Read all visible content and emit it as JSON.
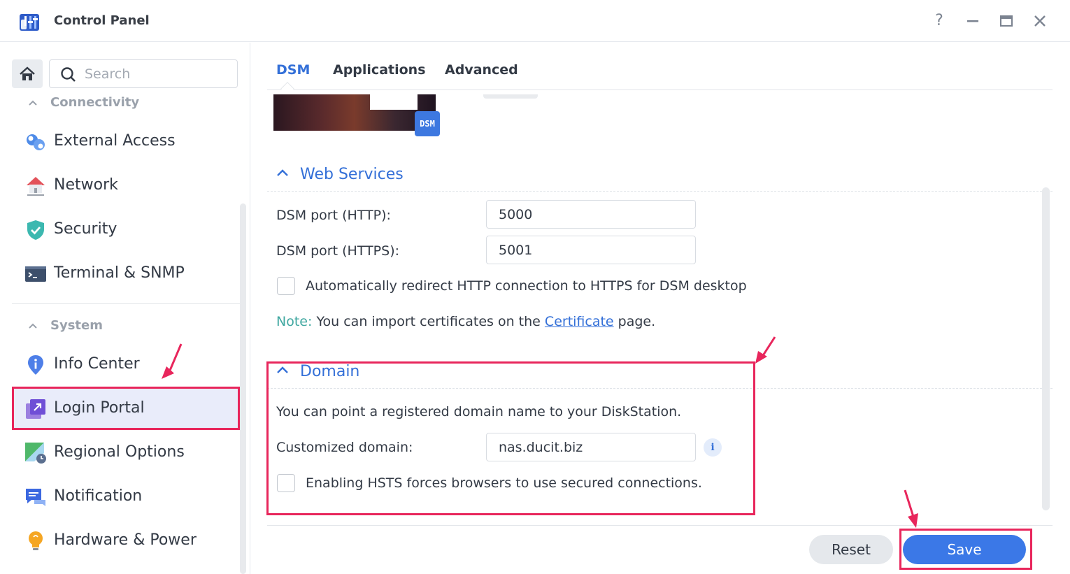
{
  "window": {
    "title": "Control Panel",
    "help_glyph": "?",
    "minimize_glyph": "—",
    "close_glyph": "✕"
  },
  "sidebar": {
    "search_placeholder": "Search",
    "groups": [
      {
        "label": "Connectivity",
        "items": [
          {
            "label": "External Access",
            "icon": "external-access-icon"
          },
          {
            "label": "Network",
            "icon": "network-icon"
          },
          {
            "label": "Security",
            "icon": "security-shield-icon"
          },
          {
            "label": "Terminal & SNMP",
            "icon": "terminal-icon"
          }
        ]
      },
      {
        "label": "System",
        "items": [
          {
            "label": "Info Center",
            "icon": "info-center-icon"
          },
          {
            "label": "Login Portal",
            "icon": "login-portal-icon",
            "active": true
          },
          {
            "label": "Regional Options",
            "icon": "regional-options-icon"
          },
          {
            "label": "Notification",
            "icon": "notification-icon"
          },
          {
            "label": "Hardware & Power",
            "icon": "hardware-power-icon"
          }
        ]
      }
    ]
  },
  "tabs": [
    {
      "label": "DSM",
      "active": true
    },
    {
      "label": "Applications",
      "active": false
    },
    {
      "label": "Advanced",
      "active": false
    }
  ],
  "banner": {
    "badge": "DSM"
  },
  "web_services": {
    "heading": "Web Services",
    "http_label": "DSM port (HTTP):",
    "http_value": "5000",
    "https_label": "DSM port (HTTPS):",
    "https_value": "5001",
    "redirect_label": "Automatically redirect HTTP connection to HTTPS for DSM desktop",
    "redirect_checked": false,
    "note_prefix": "Note:",
    "note_text": "You can import certificates on the",
    "note_link": "Certificate",
    "note_suffix": "page."
  },
  "domain": {
    "heading": "Domain",
    "description": "You can point a registered domain name to your DiskStation.",
    "custom_label": "Customized domain:",
    "custom_value": "nas.ducit.biz",
    "info_glyph": "i",
    "hsts_label": "Enabling HSTS forces browsers to use secured connections.",
    "hsts_checked": false
  },
  "footer": {
    "reset_label": "Reset",
    "save_label": "Save"
  },
  "colors": {
    "accent": "#3470d8",
    "highlight": "#e8265c",
    "note": "#3fa7a0"
  }
}
